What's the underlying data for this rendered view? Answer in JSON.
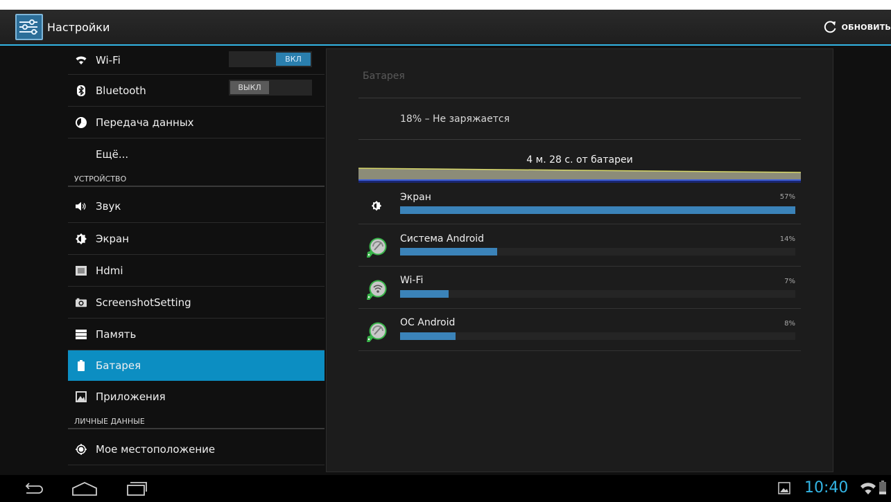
{
  "action_bar": {
    "title": "Настройки",
    "refresh_label": "ОБНОВИТЬ"
  },
  "colors": {
    "accent": "#33b5e5",
    "selected": "#0c8ec2",
    "bar_fill": "#3b83b9"
  },
  "settings": {
    "wifi": {
      "label": "Wi-Fi",
      "toggle": "ВКЛ",
      "icon": "wifi-icon"
    },
    "bluetooth": {
      "label": "Bluetooth",
      "toggle": "ВЫКЛ",
      "icon": "bluetooth-icon"
    },
    "data_usage": {
      "label": "Передача данных",
      "icon": "data-usage-icon"
    },
    "more": {
      "label": "Ещё..."
    },
    "section_device": "УСТРОЙСТВО",
    "sound": {
      "label": "Звук",
      "icon": "sound-icon"
    },
    "display": {
      "label": "Экран",
      "icon": "brightness-icon"
    },
    "hdmi": {
      "label": "Hdmi",
      "icon": "hdmi-icon"
    },
    "screenshot": {
      "label": "ScreenshotSetting",
      "icon": "camera-icon"
    },
    "storage": {
      "label": "Память",
      "icon": "storage-icon"
    },
    "battery": {
      "label": "Батарея",
      "icon": "battery-icon",
      "selected": true
    },
    "apps": {
      "label": "Приложения",
      "icon": "apps-icon"
    },
    "section_personal": "ЛИЧНЫЕ ДАННЫЕ",
    "location": {
      "label": "Мое местоположение",
      "icon": "location-icon"
    }
  },
  "battery": {
    "header": "Батарея",
    "status": "18% – Не заряжается",
    "graph_title": "4 м. 28 с. от батареи",
    "usage": [
      {
        "name": "Экран",
        "percent_label": "57%",
        "value": 57,
        "icon": "brightness-icon"
      },
      {
        "name": "Система Android",
        "percent_label": "14%",
        "value": 14,
        "icon": "android-system-icon"
      },
      {
        "name": "Wi-Fi",
        "percent_label": "7%",
        "value": 7,
        "icon": "android-wifi-icon"
      },
      {
        "name": "ОС Android",
        "percent_label": "8%",
        "value": 8,
        "icon": "android-os-icon"
      }
    ]
  },
  "status_bar": {
    "time": "10:40"
  }
}
